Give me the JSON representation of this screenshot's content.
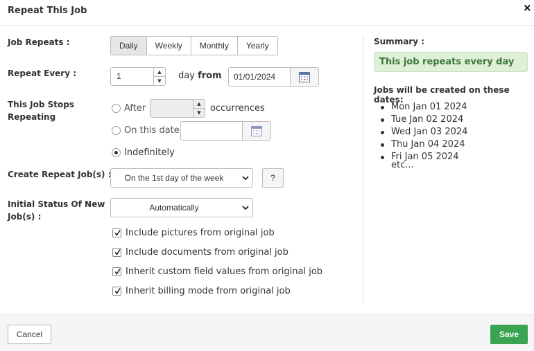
{
  "dialog": {
    "title": "Repeat This Job",
    "close_label": "×"
  },
  "form": {
    "job_repeats": {
      "label": "Job Repeats :",
      "options": [
        "Daily",
        "Weekly",
        "Monthly",
        "Yearly"
      ],
      "selected": "Daily"
    },
    "repeat_every": {
      "label": "Repeat Every :",
      "value": "1",
      "unit_text": "day",
      "from_text": "from",
      "from_date": "01/01/2024"
    },
    "stops": {
      "label_line1": "This Job Stops",
      "label_line2": "Repeating",
      "after_label": "After",
      "after_value": "",
      "occurrences_label": "occurrences",
      "on_date_label": "On this date",
      "on_date_value": "",
      "indefinitely_label": "Indefinitely",
      "selected": "indefinitely"
    },
    "create_repeat": {
      "label": "Create Repeat Job(s) :",
      "selected": "On the 1st day of the week",
      "help_label": "?"
    },
    "initial_status": {
      "label_line1": "Initial Status Of New",
      "label_line2": "Job(s) :",
      "selected": "Automatically"
    },
    "checkboxes": [
      {
        "label": "Include pictures from original job",
        "checked": true
      },
      {
        "label": "Include documents from original job",
        "checked": true
      },
      {
        "label": "Inherit custom field values from original job",
        "checked": true
      },
      {
        "label": "Inherit billing mode from original job",
        "checked": true
      }
    ]
  },
  "summary": {
    "label": "Summary :",
    "text": "This job repeats every day",
    "dates_header": "Jobs will be created on these dates:",
    "dates": [
      "Mon Jan 01 2024",
      "Tue Jan 02 2024",
      "Wed Jan 03 2024",
      "Thu Jan 04 2024",
      "Fri Jan 05 2024"
    ],
    "etc": "etc..."
  },
  "footer": {
    "cancel_label": "Cancel",
    "save_label": "Save"
  },
  "colors": {
    "save_green": "#3aa452",
    "summary_bg": "#dff0d8",
    "summary_text": "#3c763d"
  }
}
